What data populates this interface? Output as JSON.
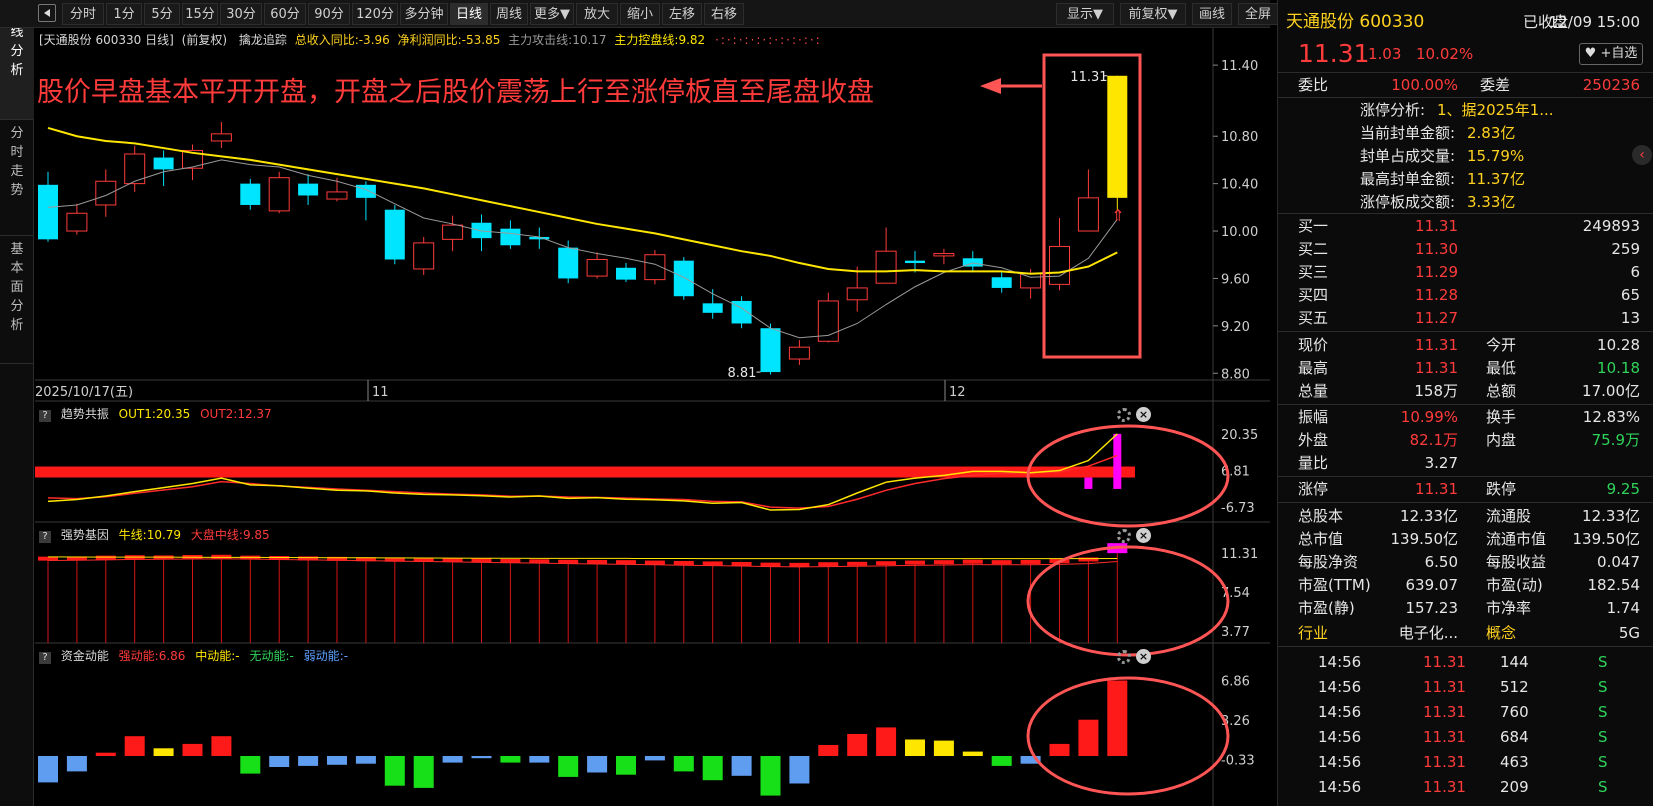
{
  "toolbar": {
    "left": [
      "分时",
      "1分",
      "5分",
      "15分",
      "30分",
      "60分",
      "90分",
      "120分",
      "多分钟",
      "日线",
      "周线",
      "更多▼",
      "放大",
      "缩小",
      "左移",
      "右移"
    ],
    "right": [
      "显示▼",
      "前复权▼",
      "画线",
      "全屏"
    ],
    "active": "日线"
  },
  "vtabs": [
    {
      "chars": "K线分析"
    },
    {
      "chars": "分时走势"
    },
    {
      "chars": "基本面分析"
    }
  ],
  "main_header": {
    "symbol": "[天通股份 600330 日线]",
    "adjust": "(前复权)",
    "indicator": "擒龙追踪",
    "revenue": "总收入同比:-3.96",
    "profit": "净利润同比:-53.85",
    "attack": "主力攻击线:10.17",
    "control": "主力控盘线:9.82"
  },
  "annotation": "股价早盘基本平开开盘，开盘之后股价震荡上行至涨停板直至尾盘收盘",
  "price_axis": [
    "11.40",
    "10.80",
    "10.40",
    "10.00",
    "9.60",
    "9.20",
    "8.80"
  ],
  "date_axis": {
    "start": "2025/10/17(五)",
    "m11": "11",
    "m12": "12"
  },
  "labels": {
    "high": "11.31",
    "low": "8.81"
  },
  "chart_data": [
    {
      "type": "candlestick",
      "ylim": [
        8.76,
        11.46
      ],
      "candles": [
        [
          10.39,
          9.93,
          9.91,
          10.5
        ],
        [
          10.0,
          10.15,
          9.97,
          10.23
        ],
        [
          10.22,
          10.42,
          10.12,
          10.52
        ],
        [
          10.4,
          10.65,
          10.33,
          10.72
        ],
        [
          10.62,
          10.52,
          10.38,
          10.68
        ],
        [
          10.53,
          10.68,
          10.43,
          10.73
        ],
        [
          10.76,
          10.82,
          10.7,
          10.92
        ],
        [
          10.4,
          10.22,
          10.18,
          10.44
        ],
        [
          10.17,
          10.45,
          10.15,
          10.5
        ],
        [
          10.4,
          10.3,
          10.22,
          10.48
        ],
        [
          10.27,
          10.33,
          10.25,
          10.45
        ],
        [
          10.39,
          10.28,
          10.09,
          10.42
        ],
        [
          10.18,
          9.76,
          9.72,
          10.22
        ],
        [
          9.68,
          9.9,
          9.63,
          9.95
        ],
        [
          9.93,
          10.05,
          9.83,
          10.13
        ],
        [
          10.07,
          9.94,
          9.83,
          10.14
        ],
        [
          10.02,
          9.88,
          9.85,
          10.09
        ],
        [
          9.95,
          9.93,
          9.85,
          10.03
        ],
        [
          9.86,
          9.6,
          9.56,
          9.92
        ],
        [
          9.62,
          9.76,
          9.6,
          9.82
        ],
        [
          9.69,
          9.59,
          9.57,
          9.73
        ],
        [
          9.59,
          9.8,
          9.55,
          9.84
        ],
        [
          9.75,
          9.45,
          9.42,
          9.78
        ],
        [
          9.39,
          9.31,
          9.26,
          9.51
        ],
        [
          9.41,
          9.22,
          9.18,
          9.45
        ],
        [
          9.18,
          8.81,
          8.79,
          9.22
        ],
        [
          8.92,
          9.02,
          8.87,
          9.08
        ],
        [
          9.07,
          9.41,
          9.06,
          9.48
        ],
        [
          9.42,
          9.52,
          9.32,
          9.7
        ],
        [
          9.56,
          9.83,
          9.56,
          10.03
        ],
        [
          9.75,
          9.73,
          9.65,
          9.83
        ],
        [
          9.79,
          9.81,
          9.72,
          9.85
        ],
        [
          9.77,
          9.7,
          9.65,
          9.83
        ],
        [
          9.61,
          9.52,
          9.48,
          9.66
        ],
        [
          9.52,
          9.64,
          9.43,
          9.68
        ],
        [
          9.55,
          9.87,
          9.5,
          10.11
        ],
        [
          10.0,
          10.28,
          10.0,
          10.52
        ],
        [
          10.28,
          11.31,
          10.18,
          11.31
        ]
      ],
      "ma_yellow": [
        10.87,
        10.8,
        10.76,
        10.74,
        10.7,
        10.66,
        10.63,
        10.6,
        10.56,
        10.52,
        10.48,
        10.44,
        10.4,
        10.36,
        10.31,
        10.26,
        10.21,
        10.16,
        10.11,
        10.06,
        10.02,
        9.98,
        9.93,
        9.88,
        9.83,
        9.79,
        9.73,
        9.68,
        9.66,
        9.66,
        9.67,
        9.66,
        9.66,
        9.66,
        9.64,
        9.65,
        9.7,
        9.82
      ],
      "ma_gray": [
        10.2,
        10.22,
        10.3,
        10.42,
        10.5,
        10.54,
        10.6,
        10.56,
        10.54,
        10.47,
        10.42,
        10.35,
        10.23,
        10.11,
        10.06,
        10.0,
        9.98,
        9.95,
        9.86,
        9.81,
        9.77,
        9.72,
        9.61,
        9.47,
        9.35,
        9.18,
        9.1,
        9.12,
        9.22,
        9.38,
        9.53,
        9.65,
        9.73,
        9.69,
        9.61,
        9.62,
        9.77,
        10.1
      ]
    },
    {
      "type": "line",
      "title": "趋势共振",
      "out1": "OUT1:20.35",
      "out2": "OUT2:12.37",
      "ticks": [
        "20.35",
        "6.81",
        "-6.73"
      ],
      "ylim": [
        -10,
        24
      ],
      "out1_series": [
        -4.6,
        -3.9,
        -2.6,
        -1.0,
        0.5,
        2.0,
        4.0,
        1.5,
        1.2,
        0.3,
        -0.5,
        -0.7,
        -1.5,
        -2.0,
        -2.2,
        -2.5,
        -3.0,
        -2.6,
        -3.5,
        -3.2,
        -3.8,
        -4.0,
        -4.4,
        -5.3,
        -5.0,
        -7.8,
        -7.6,
        -5.8,
        -1.5,
        2.5,
        4.0,
        5.0,
        6.5,
        6.5,
        6.0,
        6.8,
        10.5,
        20.35
      ],
      "out2_series": [
        -3.3,
        -3.6,
        -2.9,
        -1.6,
        -0.4,
        0.8,
        2.7,
        2.0,
        1.1,
        0.6,
        0.0,
        -0.5,
        -1.0,
        -1.5,
        -1.9,
        -2.2,
        -2.7,
        -2.6,
        -3.0,
        -3.1,
        -3.4,
        -3.7,
        -3.9,
        -4.6,
        -4.8,
        -6.7,
        -7.1,
        -6.5,
        -3.8,
        -0.5,
        2.0,
        3.8,
        5.0,
        5.8,
        6.0,
        6.3,
        8.4,
        12.37
      ],
      "bars": [
        0,
        0,
        0,
        0,
        0,
        0,
        0,
        0,
        0,
        0,
        0,
        0,
        0,
        0,
        0,
        0,
        0,
        0,
        0,
        0,
        0,
        0,
        0,
        0,
        0,
        0,
        0,
        0,
        0,
        0,
        0,
        0,
        0,
        0,
        0,
        0,
        4.2,
        20.35
      ]
    },
    {
      "type": "bar",
      "title": "强势基因",
      "bull": "牛线:10.79",
      "mid": "大盘中线:9.85",
      "ticks": [
        "11.31",
        "7.54",
        "3.77"
      ],
      "ylim": [
        2.6,
        12.1
      ],
      "values": [
        10.68,
        10.7,
        10.78,
        10.82,
        10.8,
        10.84,
        10.86,
        10.78,
        10.74,
        10.7,
        10.66,
        10.62,
        10.58,
        10.56,
        10.54,
        10.5,
        10.46,
        10.42,
        10.38,
        10.36,
        10.34,
        10.3,
        10.26,
        10.22,
        10.16,
        10.1,
        10.08,
        10.14,
        10.18,
        10.24,
        10.3,
        10.34,
        10.38,
        10.34,
        10.36,
        10.44,
        10.6,
        11.31
      ],
      "bull_series": [
        10.95,
        10.94,
        10.93,
        10.92,
        10.92,
        10.91,
        10.9,
        10.9,
        10.89,
        10.88,
        10.87,
        10.86,
        10.85,
        10.84,
        10.83,
        10.82,
        10.81,
        10.8,
        10.8,
        10.8,
        10.8,
        10.79,
        10.79,
        10.78,
        10.78,
        10.78,
        10.78,
        10.78,
        10.78,
        10.78,
        10.78,
        10.78,
        10.78,
        10.78,
        10.78,
        10.78,
        10.78,
        10.79
      ],
      "mid_series": [
        10.6,
        10.62,
        10.66,
        10.7,
        10.72,
        10.74,
        10.76,
        10.74,
        10.7,
        10.66,
        10.62,
        10.58,
        10.54,
        10.5,
        10.46,
        10.42,
        10.38,
        10.34,
        10.3,
        10.26,
        10.22,
        10.18,
        10.14,
        10.1,
        10.06,
        10.0,
        9.98,
        10.0,
        10.04,
        10.08,
        10.12,
        10.16,
        10.2,
        10.18,
        10.18,
        10.22,
        10.3,
        10.5
      ]
    },
    {
      "type": "bar",
      "title": "资金动能",
      "strong": "强动能:6.86",
      "medium": "中动能:-",
      "none": "无动能:-",
      "weak": "弱动能:-",
      "ticks": [
        "6.86",
        "3.26",
        "-0.33"
      ],
      "ylim": [
        -4.0,
        8.0
      ],
      "values": [
        -2.4,
        -1.4,
        0.3,
        1.8,
        0.7,
        1.1,
        1.8,
        -1.6,
        -1.0,
        -0.9,
        -0.8,
        -0.7,
        -2.7,
        -2.9,
        -0.6,
        -0.2,
        -0.6,
        -0.6,
        -1.9,
        -1.5,
        -1.7,
        -0.4,
        -1.4,
        -2.2,
        -1.8,
        -3.6,
        -2.5,
        1.0,
        2.0,
        2.6,
        1.5,
        1.4,
        0.4,
        -0.9,
        -0.7,
        1.1,
        3.3,
        6.86
      ],
      "colors": [
        "blue",
        "blue",
        "red",
        "red",
        "yellow",
        "red",
        "red",
        "green",
        "blue",
        "blue",
        "blue",
        "blue",
        "green",
        "green",
        "blue",
        "blue",
        "green",
        "blue",
        "green",
        "blue",
        "green",
        "blue",
        "green",
        "green",
        "blue",
        "green",
        "blue",
        "red",
        "red",
        "red",
        "yellow",
        "yellow",
        "yellow",
        "green",
        "blue",
        "red",
        "red",
        "red"
      ]
    }
  ],
  "panel": {
    "name": "天通股份 600330",
    "status": "已收盘",
    "date": "12/09 15:00",
    "price": "11.31",
    "chg": "1.03",
    "pct": "10.02%",
    "watch": "+自选",
    "wb_label": "委比",
    "wb": "100.00%",
    "wc_label": "委差",
    "wc": "250236",
    "analysis": [
      {
        "k": "涨停分析:",
        "v": "1、据2025年1..."
      },
      {
        "k": "当前封单金额:",
        "v": "2.83亿"
      },
      {
        "k": "封单占成交量:",
        "v": "15.79%"
      },
      {
        "k": "最高封单金额:",
        "v": "11.37亿"
      },
      {
        "k": "涨停板成交额:",
        "v": "3.33亿"
      }
    ],
    "buys": [
      {
        "k": "买一",
        "p": "11.31",
        "v": "249893"
      },
      {
        "k": "买二",
        "p": "11.30",
        "v": "259"
      },
      {
        "k": "买三",
        "p": "11.29",
        "v": "6"
      },
      {
        "k": "买四",
        "p": "11.28",
        "v": "65"
      },
      {
        "k": "买五",
        "p": "11.27",
        "v": "13"
      }
    ],
    "quote": [
      {
        "k1": "现价",
        "v1": "11.31",
        "k2": "今开",
        "v2": "10.28",
        "c1": "red",
        "c2": "white"
      },
      {
        "k1": "最高",
        "v1": "11.31",
        "k2": "最低",
        "v2": "10.18",
        "c1": "red",
        "c2": "green"
      },
      {
        "k1": "总量",
        "v1": "158万",
        "k2": "总额",
        "v2": "17.00亿",
        "c1": "white",
        "c2": "white"
      },
      {
        "k1": "振幅",
        "v1": "10.99%",
        "k2": "换手",
        "v2": "12.83%",
        "c1": "red",
        "c2": "white"
      },
      {
        "k1": "外盘",
        "v1": "82.1万",
        "k2": "内盘",
        "v2": "75.9万",
        "c1": "red",
        "c2": "green"
      },
      {
        "k1": "量比",
        "v1": "3.27",
        "k2": "",
        "v2": "",
        "c1": "white",
        "c2": "white"
      },
      {
        "k1": "涨停",
        "v1": "11.31",
        "k2": "跌停",
        "v2": "9.25",
        "c1": "red",
        "c2": "green"
      }
    ],
    "fund": [
      {
        "k1": "总股本",
        "v1": "12.33亿",
        "k2": "流通股",
        "v2": "12.33亿"
      },
      {
        "k1": "总市值",
        "v1": "139.50亿",
        "k2": "流通市值",
        "v2": "139.50亿"
      },
      {
        "k1": "每股净资",
        "v1": "6.50",
        "k2": "每股收益",
        "v2": "0.047"
      },
      {
        "k1": "市盈(TTM)",
        "v1": "639.07",
        "k2": "市盈(动)",
        "v2": "182.54"
      },
      {
        "k1": "市盈(静)",
        "v1": "157.23",
        "k2": "市净率",
        "v2": "1.74"
      }
    ],
    "industry": {
      "k1": "行业",
      "v1": "电子化...",
      "k2": "概念",
      "v2": "5G"
    },
    "ticks": [
      {
        "t": "14:56",
        "p": "11.31",
        "v": "144",
        "s": "S"
      },
      {
        "t": "14:56",
        "p": "11.31",
        "v": "512",
        "s": "S"
      },
      {
        "t": "14:56",
        "p": "11.31",
        "v": "760",
        "s": "S"
      },
      {
        "t": "14:56",
        "p": "11.31",
        "v": "684",
        "s": "S"
      },
      {
        "t": "14:56",
        "p": "11.31",
        "v": "463",
        "s": "S"
      },
      {
        "t": "14:56",
        "p": "11.31",
        "v": "209",
        "s": "S"
      }
    ]
  },
  "colors": {
    "up": "#ff3b3b",
    "down": "#00e5ff",
    "ma1": "#ffe600",
    "ma2": "#9a9a9a",
    "highlight": "#ff5555",
    "magenta": "#ff00ff"
  }
}
